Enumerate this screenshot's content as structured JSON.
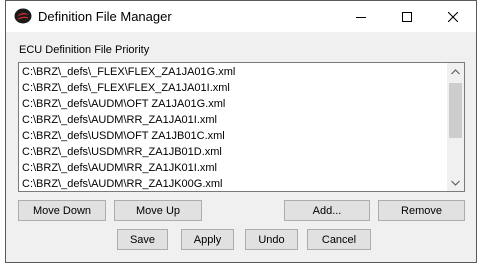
{
  "window": {
    "title": "Definition File Manager"
  },
  "title_controls": {
    "minimize_icon": "minimize-icon",
    "maximize_icon": "maximize-icon",
    "close_icon": "close-icon"
  },
  "group": {
    "label": "ECU Definition File Priority"
  },
  "files": [
    "C:\\BRZ\\_defs\\_FLEX\\FLEX_ZA1JA01G.xml",
    "C:\\BRZ\\_defs\\_FLEX\\FLEX_ZA1JA01I.xml",
    "C:\\BRZ\\_defs\\AUDM\\OFT ZA1JA01G.xml",
    "C:\\BRZ\\_defs\\AUDM\\RR_ZA1JA01I.xml",
    "C:\\BRZ\\_defs\\USDM\\OFT ZA1JB01C.xml",
    "C:\\BRZ\\_defs\\USDM\\RR_ZA1JB01D.xml",
    "C:\\BRZ\\_defs\\AUDM\\RR_ZA1JK01I.xml",
    "C:\\BRZ\\_defs\\AUDM\\RR_ZA1JK00G.xml"
  ],
  "buttons": {
    "move_down": "Move Down",
    "move_up": "Move Up",
    "add": "Add...",
    "remove": "Remove",
    "save": "Save",
    "apply": "Apply",
    "undo": "Undo",
    "cancel": "Cancel"
  }
}
